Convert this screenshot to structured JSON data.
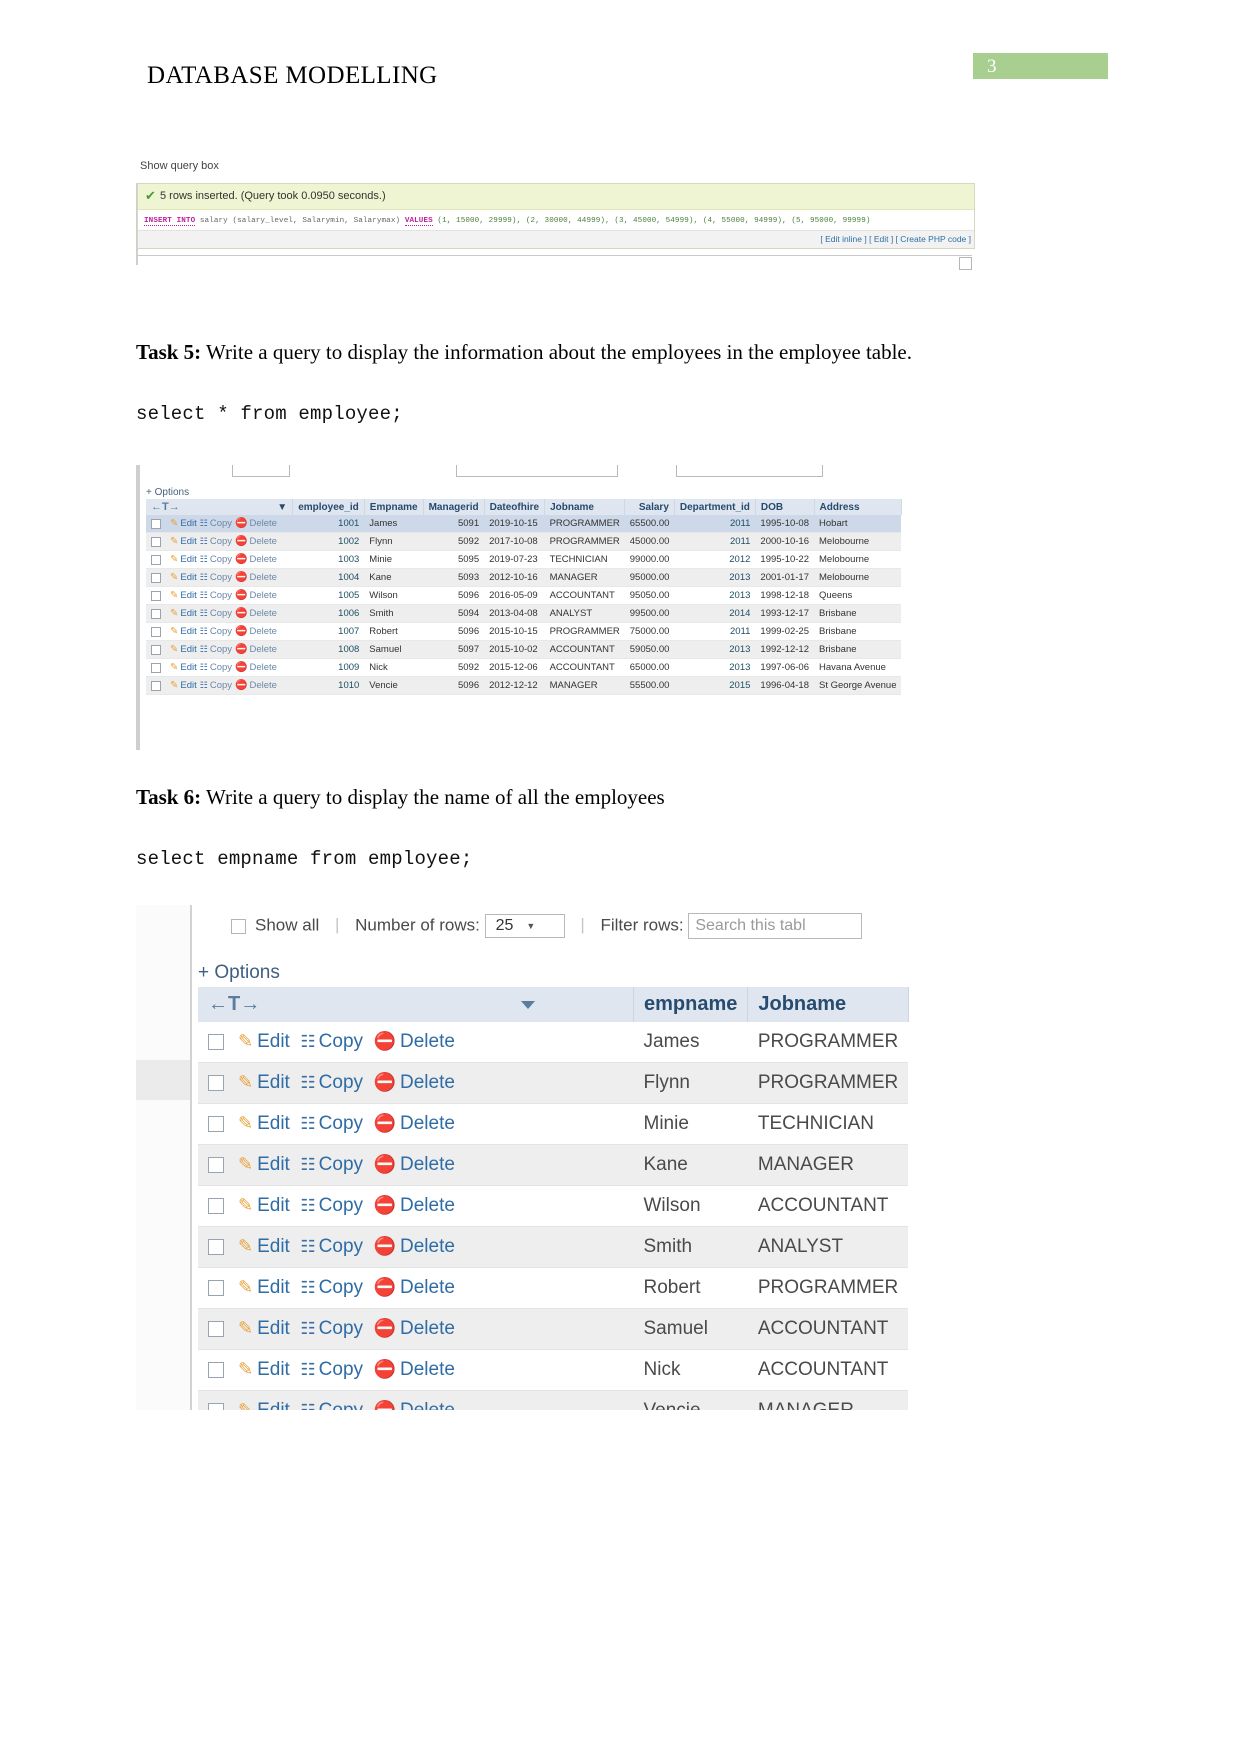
{
  "header": {
    "title": "DATABASE MODELLING",
    "page_number": "3",
    "page_number_bg": "#a8cf8f"
  },
  "screenshot_query_result": {
    "show_query_box_label": "Show query box",
    "success_message": "5 rows inserted. (Query took 0.0950 seconds.)",
    "check_icon": "✔",
    "sql": {
      "kw_insert": "INSERT INTO",
      "table_and_cols": " salary (salary_level, Salarymin, Salarymax) ",
      "kw_values": "VALUES",
      "tuples": " (1, 15000, 29999), (2, 30000, 44999), (3, 45000, 54999), (4, 55000, 94999), (5, 95000, 99999)"
    },
    "links": {
      "edit_inline": "[ Edit inline ]",
      "edit": "[ Edit ]",
      "create_php": "[ Create PHP code ]"
    }
  },
  "task5": {
    "label": "Task 5:",
    "text": " Write a query to display the information about the employees in the employee table.",
    "query": "select * from employee;"
  },
  "task6": {
    "label": "Task 6:",
    "text": " Write a query to display the name of all the employees",
    "query": "select empname from employee;"
  },
  "employee_table": {
    "options_label": "+ Options",
    "sort_caret": "▼",
    "nav_arrows": "←T→",
    "actions": {
      "edit": "Edit",
      "copy": "Copy",
      "delete": "Delete"
    },
    "columns": [
      "employee_id",
      "Empname",
      "Managerid",
      "Dateofhire",
      "Jobname",
      "Salary",
      "Department_id",
      "DOB",
      "Address"
    ],
    "rows": [
      {
        "employee_id": "1001",
        "Empname": "James",
        "Managerid": "5091",
        "Dateofhire": "2019-10-15",
        "Jobname": "PROGRAMMER",
        "Salary": "65500.00",
        "Department_id": "2011",
        "DOB": "1995-10-08",
        "Address": "Hobart"
      },
      {
        "employee_id": "1002",
        "Empname": "Flynn",
        "Managerid": "5092",
        "Dateofhire": "2017-10-08",
        "Jobname": "PROGRAMMER",
        "Salary": "45000.00",
        "Department_id": "2011",
        "DOB": "2000-10-16",
        "Address": "Melobourne"
      },
      {
        "employee_id": "1003",
        "Empname": "Minie",
        "Managerid": "5095",
        "Dateofhire": "2019-07-23",
        "Jobname": "TECHNICIAN",
        "Salary": "99000.00",
        "Department_id": "2012",
        "DOB": "1995-10-22",
        "Address": "Melobourne"
      },
      {
        "employee_id": "1004",
        "Empname": "Kane",
        "Managerid": "5093",
        "Dateofhire": "2012-10-16",
        "Jobname": "MANAGER",
        "Salary": "95000.00",
        "Department_id": "2013",
        "DOB": "2001-01-17",
        "Address": "Melobourne"
      },
      {
        "employee_id": "1005",
        "Empname": "Wilson",
        "Managerid": "5096",
        "Dateofhire": "2016-05-09",
        "Jobname": "ACCOUNTANT",
        "Salary": "95050.00",
        "Department_id": "2013",
        "DOB": "1998-12-18",
        "Address": "Queens"
      },
      {
        "employee_id": "1006",
        "Empname": "Smith",
        "Managerid": "5094",
        "Dateofhire": "2013-04-08",
        "Jobname": "ANALYST",
        "Salary": "99500.00",
        "Department_id": "2014",
        "DOB": "1993-12-17",
        "Address": "Brisbane"
      },
      {
        "employee_id": "1007",
        "Empname": "Robert",
        "Managerid": "5096",
        "Dateofhire": "2015-10-15",
        "Jobname": "PROGRAMMER",
        "Salary": "75000.00",
        "Department_id": "2011",
        "DOB": "1999-02-25",
        "Address": "Brisbane"
      },
      {
        "employee_id": "1008",
        "Empname": "Samuel",
        "Managerid": "5097",
        "Dateofhire": "2015-10-02",
        "Jobname": "ACCOUNTANT",
        "Salary": "59050.00",
        "Department_id": "2013",
        "DOB": "1992-12-12",
        "Address": "Brisbane"
      },
      {
        "employee_id": "1009",
        "Empname": "Nick",
        "Managerid": "5092",
        "Dateofhire": "2015-12-06",
        "Jobname": "ACCOUNTANT",
        "Salary": "65000.00",
        "Department_id": "2013",
        "DOB": "1997-06-06",
        "Address": "Havana Avenue"
      },
      {
        "employee_id": "1010",
        "Empname": "Vencie",
        "Managerid": "5096",
        "Dateofhire": "2012-12-12",
        "Jobname": "MANAGER",
        "Salary": "55500.00",
        "Department_id": "2015",
        "DOB": "1996-04-18",
        "Address": "St George Avenue"
      }
    ]
  },
  "empname_table": {
    "toolbar": {
      "show_all_label": "Show all",
      "number_of_rows_label": "Number of rows:",
      "rows_value": "25",
      "caret": "▼",
      "filter_rows_label": "Filter rows:",
      "filter_placeholder": "Search this tabl"
    },
    "options_label": "+ Options",
    "nav_arrows": "←T→",
    "sort_caret": "▼",
    "actions": {
      "edit": "Edit",
      "copy": "Copy",
      "delete": "Delete"
    },
    "columns": [
      "empname",
      "Jobname"
    ],
    "rows": [
      {
        "empname": "James",
        "Jobname": "PROGRAMMER"
      },
      {
        "empname": "Flynn",
        "Jobname": "PROGRAMMER"
      },
      {
        "empname": "Minie",
        "Jobname": "TECHNICIAN"
      },
      {
        "empname": "Kane",
        "Jobname": "MANAGER"
      },
      {
        "empname": "Wilson",
        "Jobname": "ACCOUNTANT"
      },
      {
        "empname": "Smith",
        "Jobname": "ANALYST"
      },
      {
        "empname": "Robert",
        "Jobname": "PROGRAMMER"
      },
      {
        "empname": "Samuel",
        "Jobname": "ACCOUNTANT"
      },
      {
        "empname": "Nick",
        "Jobname": "ACCOUNTANT"
      },
      {
        "empname": "Vencie",
        "Jobname": "MANAGER"
      }
    ]
  }
}
